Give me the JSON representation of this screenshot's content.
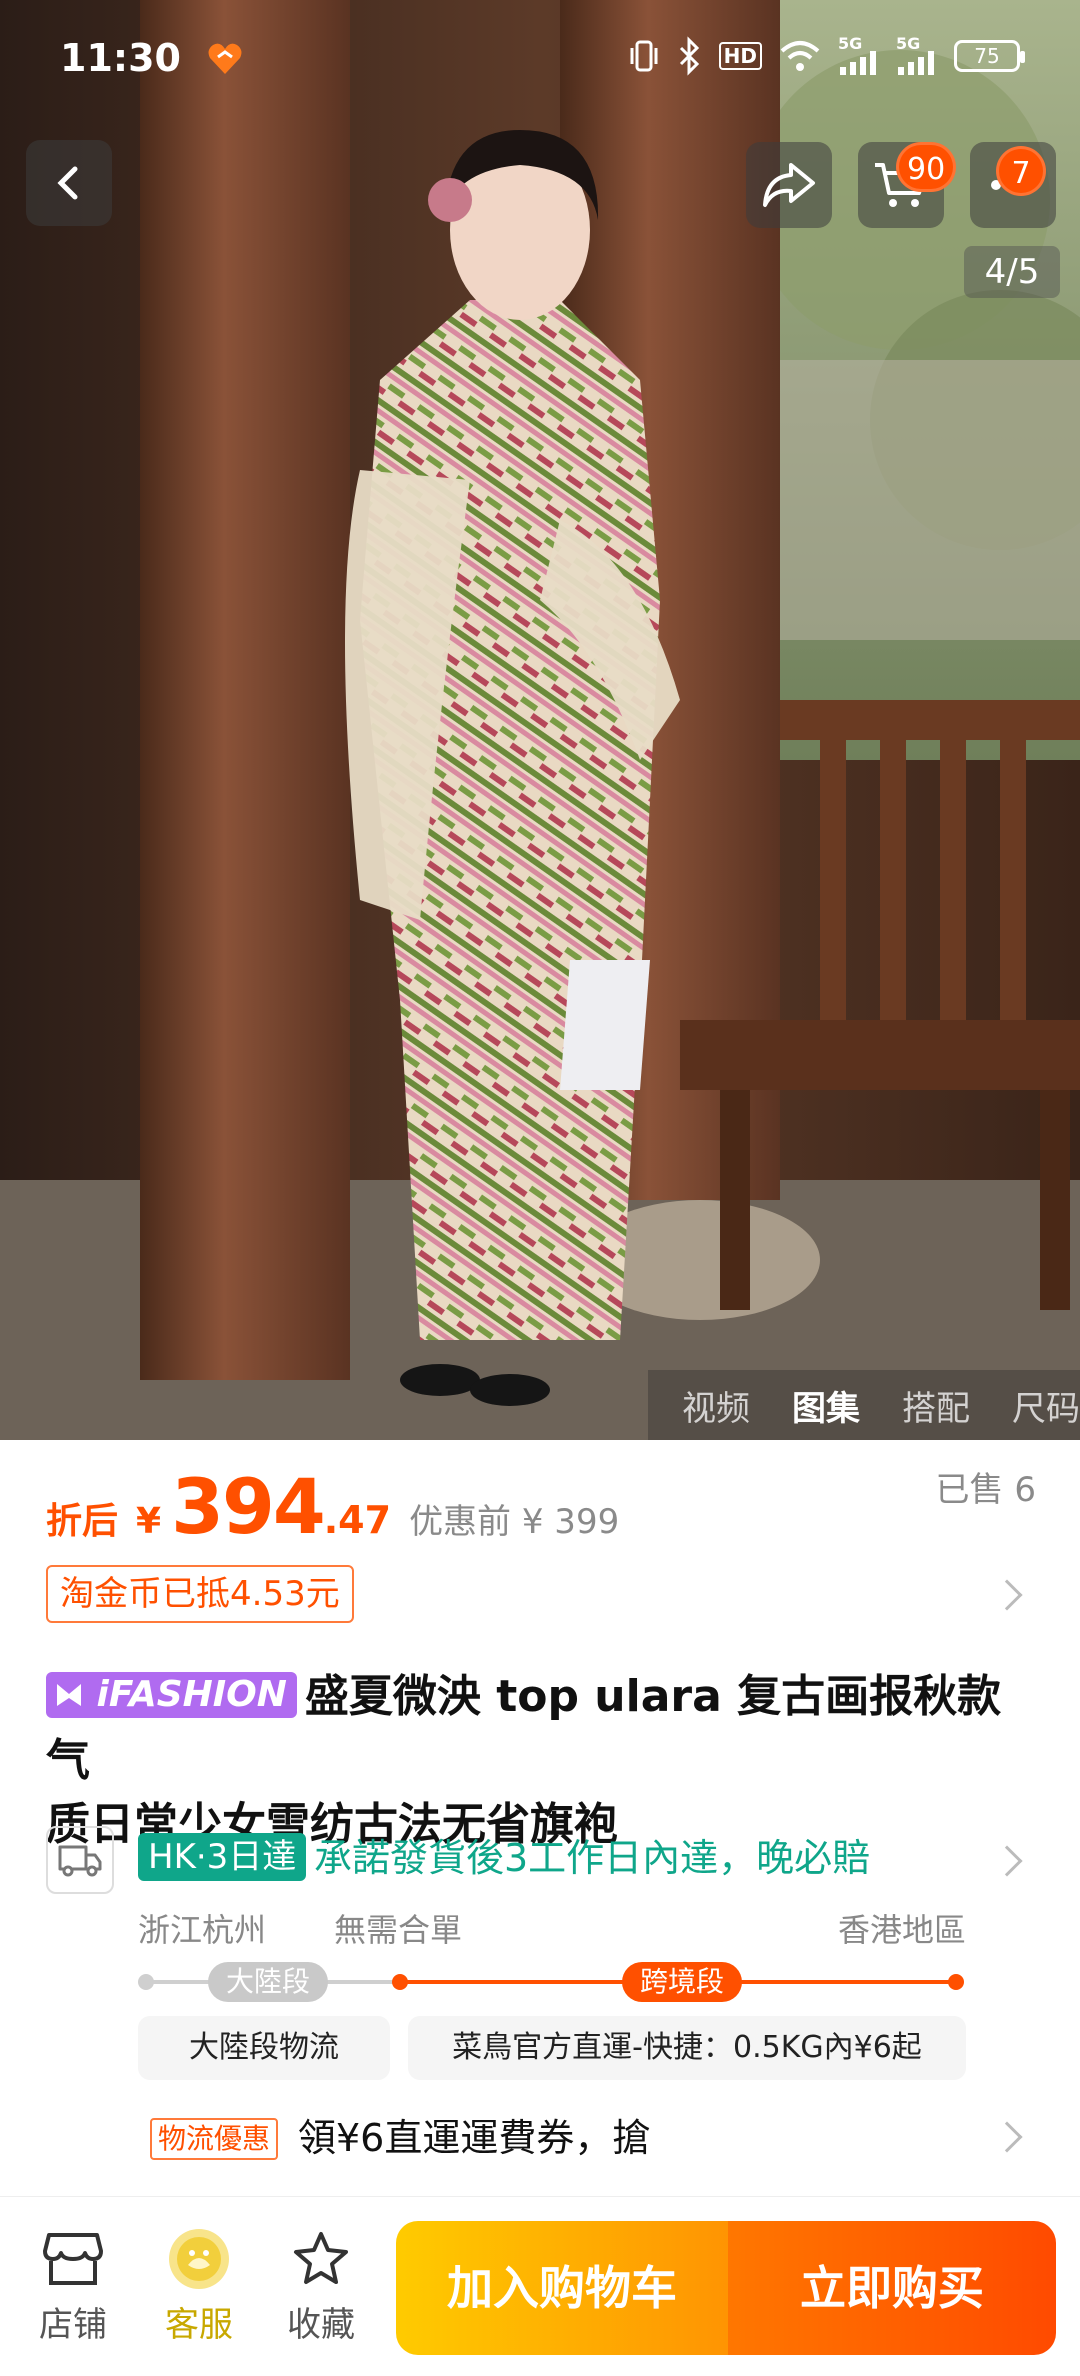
{
  "status_bar": {
    "time": "11:30",
    "network_1": "5G",
    "network_2": "5G",
    "hd_label": "HD",
    "battery": "75"
  },
  "gallery": {
    "counter": "4/5",
    "tabs": [
      "视频",
      "图集",
      "搭配",
      "尺码"
    ],
    "active_tab": "图集",
    "cart_count": "90",
    "message_count": "7"
  },
  "price": {
    "prefix": "折后",
    "currency": "¥",
    "integer": "394",
    "decimal": ".47",
    "before_label": "优惠前 ¥ 399",
    "sold": "已售 6"
  },
  "coin_tag": "淘金币已抵4.53元",
  "title": {
    "brand_tag": "iFASHION",
    "line1": "盛夏微泱 top ulara 复古画报秋款气",
    "line2": "质日常少女雪纺古法无省旗袍"
  },
  "logistics": {
    "tag": "HK·3日達",
    "promise": "承諾發貨後3工作日內達，晚必賠",
    "origin": "浙江杭州",
    "no_merge": "無需合單",
    "destination": "香港地區",
    "segment_mainland": "大陸段",
    "segment_cross": "跨境段",
    "mainland_logistics": "大陸段物流",
    "cross_logistics": "菜鳥官方直運-快捷：0.5KG內¥6起",
    "coupon_tag": "物流優惠",
    "coupon_text": "領¥6直運運費券，搶"
  },
  "bottom_bar": {
    "store": "店铺",
    "service": "客服",
    "favorite": "收藏",
    "add_to_cart": "加入购物车",
    "buy_now": "立即购买"
  },
  "colors": {
    "accent": "#ff5000",
    "green": "#0fa68a",
    "ifashion": "#b06bf0",
    "cart_gradient_start": "#ffcb00",
    "buy_gradient_end": "#ff4a00"
  }
}
